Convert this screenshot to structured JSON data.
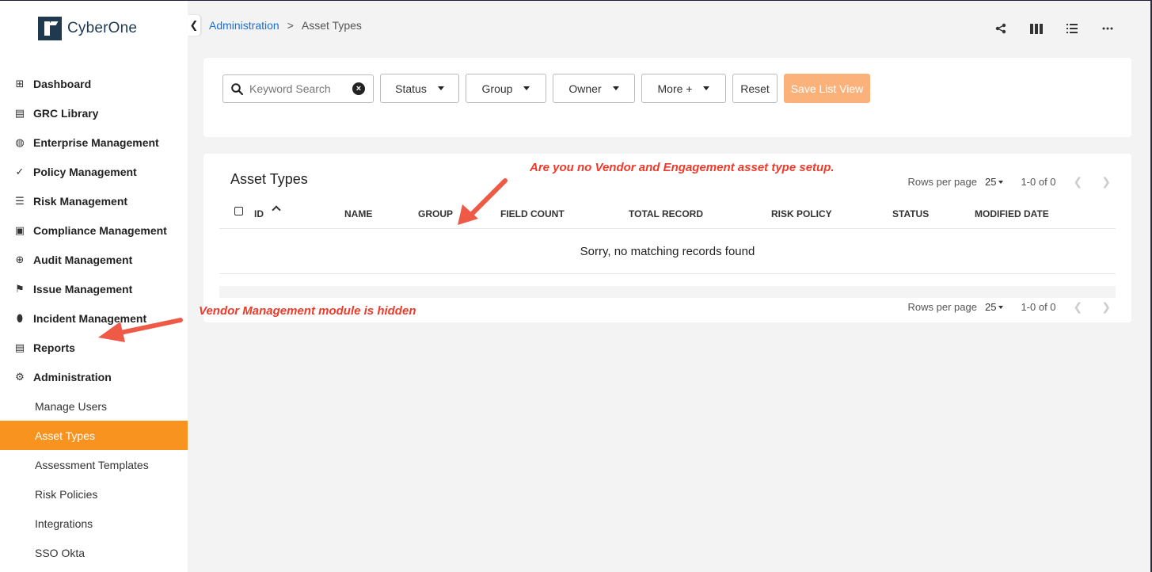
{
  "app": {
    "logo_text": "CyberOne"
  },
  "sidebar": {
    "items": [
      {
        "label": "Dashboard",
        "icon": "dashboard-icon",
        "glyph": "⊞"
      },
      {
        "label": "GRC Library",
        "icon": "book-icon",
        "glyph": "▤"
      },
      {
        "label": "Enterprise Management",
        "icon": "globe-icon",
        "glyph": "◍"
      },
      {
        "label": "Policy Management",
        "icon": "check-double-icon",
        "glyph": "✓"
      },
      {
        "label": "Risk Management",
        "icon": "list-icon",
        "glyph": "☰"
      },
      {
        "label": "Compliance Management",
        "icon": "clipboard-check-icon",
        "glyph": "▣"
      },
      {
        "label": "Audit Management",
        "icon": "crosshairs-icon",
        "glyph": "⊕"
      },
      {
        "label": "Issue Management",
        "icon": "flag-icon",
        "glyph": "⚑"
      },
      {
        "label": "Incident Management",
        "icon": "fire-icon",
        "glyph": "⬮"
      },
      {
        "label": "Reports",
        "icon": "file-icon",
        "glyph": "▤"
      },
      {
        "label": "Administration",
        "icon": "gear-icon",
        "glyph": "⚙"
      }
    ],
    "sub_items": [
      {
        "label": "Manage Users",
        "active": false
      },
      {
        "label": "Asset Types",
        "active": true
      },
      {
        "label": "Assessment Templates",
        "active": false
      },
      {
        "label": "Risk Policies",
        "active": false
      },
      {
        "label": "Integrations",
        "active": false
      },
      {
        "label": "SSO Okta",
        "active": false
      }
    ]
  },
  "breadcrumb": {
    "parent": "Administration",
    "separator": ">",
    "current": "Asset Types"
  },
  "header_icons": [
    "share-icon",
    "columns-icon",
    "list-view-icon",
    "more-options-icon"
  ],
  "filters": {
    "search_placeholder": "Keyword Search",
    "status_label": "Status",
    "group_label": "Group",
    "owner_label": "Owner",
    "more_label": "More +",
    "reset_label": "Reset",
    "save_label": "Save List View"
  },
  "table": {
    "title": "Asset Types",
    "columns": [
      "ID",
      "NAME",
      "GROUP",
      "FIELD COUNT",
      "TOTAL RECORD",
      "RISK POLICY",
      "STATUS",
      "MODIFIED DATE"
    ],
    "empty_message": "Sorry, no matching records found",
    "rows_per_page_label": "Rows per page",
    "rows_per_page": "25",
    "range": "1-0 of 0"
  },
  "annotations": {
    "top_note": "Are you no Vendor and Engagement asset type setup.",
    "side_note": "Vendor Management module is hidden"
  },
  "colors": {
    "accent": "#f7931e",
    "link": "#1a6fd6",
    "annotation": "#ee3a2a",
    "save_button": "#fbb27a"
  }
}
